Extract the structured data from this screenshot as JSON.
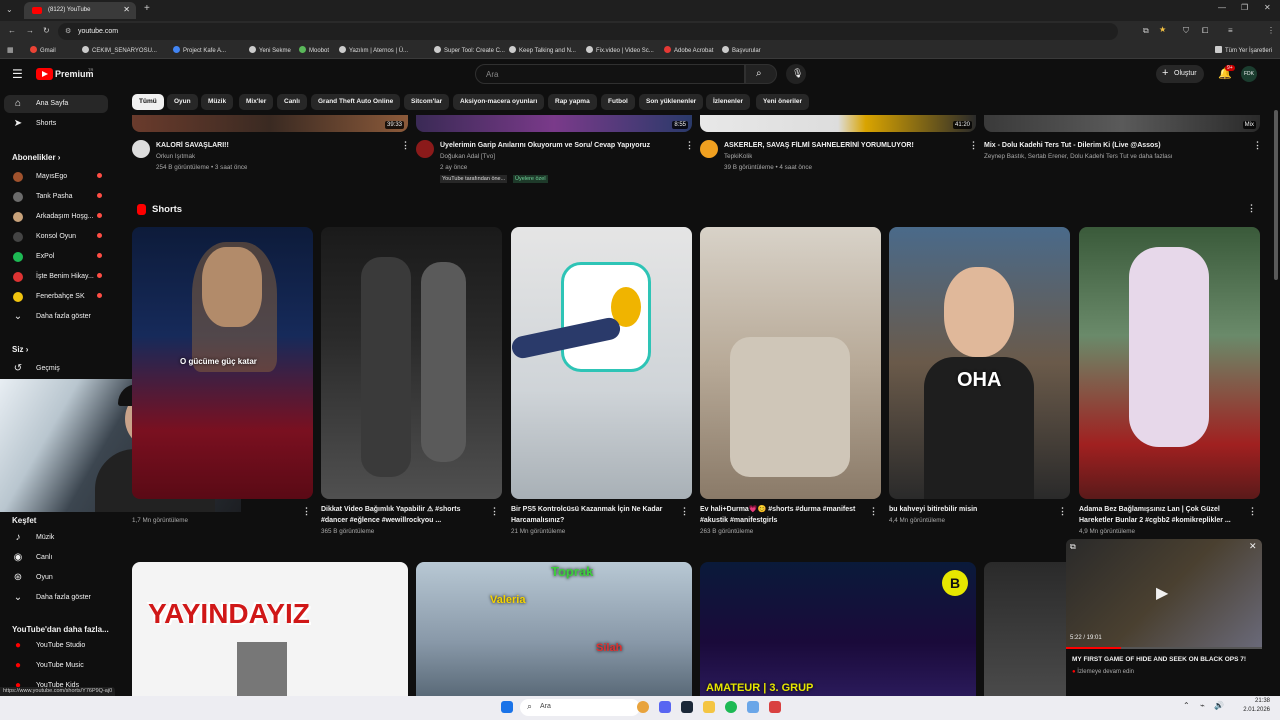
{
  "browser": {
    "tab_title": "(8122) YouTube",
    "url": "youtube.com",
    "bookmarks": [
      "Gmail",
      "CEKIM_SENARYOSU...",
      "Project Kafe A...",
      "Yeni Sekme",
      "Moobot",
      "Yazılım | Aternos | Ü...",
      "Super Tool: Create C...",
      "Keep Talking and N...",
      "Fix.video | Video Sc...",
      "Adobe Acrobat",
      "Başvurular"
    ],
    "all_bookmarks": "Tüm Yer İşaretleri"
  },
  "header": {
    "logo_text": "Premium",
    "logo_sup": "TR",
    "search_placeholder": "Ara",
    "create_label": "Oluştur",
    "notif_count": "9+",
    "avatar_text": "FDK"
  },
  "sidebar": {
    "home": "Ana Sayfa",
    "shorts": "Shorts",
    "subscriptions_title": "Abonelikler",
    "subs": [
      "MayısEgo",
      "Tank Pasha",
      "Arkadaşım Hoşg...",
      "Konsol Oyun",
      "ExPol",
      "İşte Benim Hikay...",
      "Fenerbahçe SK"
    ],
    "show_more": "Daha fazla göster",
    "you_title": "Siz",
    "history": "Geçmiş",
    "explore_title": "Keşfet",
    "explore": [
      "Müzik",
      "Canlı",
      "Oyun"
    ],
    "show_more2": "Daha fazla göster",
    "more_title": "YouTube'dan daha fazla...",
    "more_items": [
      "YouTube Studio",
      "YouTube Music",
      "YouTube Kids"
    ]
  },
  "chips": [
    "Tümü",
    "Oyun",
    "Müzik",
    "Mix'ler",
    "Canlı",
    "Grand Theft Auto Online",
    "Sitcom'lar",
    "Aksiyon-macera oyunları",
    "Rap yapma",
    "Futbol",
    "Son yüklenenler",
    "İzlenenler",
    "Yeni öneriler"
  ],
  "top_videos": [
    {
      "title": "KALORİ SAVAŞLARI!!",
      "channel": "Orkun Işıtmak",
      "meta": "254 B görüntüleme • 3 saat önce",
      "duration": "39:33"
    },
    {
      "title": "Üyelerimin Garip Anılarını Okuyorum ve Soru/ Cevap Yapıyoruz",
      "channel": "Doğukan Adal [Tvo]",
      "meta": "2 ay önce",
      "extra1": "YouTube tarafından öne...",
      "extra2": "Üyelere özel",
      "duration": "8:55"
    },
    {
      "title": "ASKERLER, SAVAŞ FİLMİ SAHNELERİNİ YORUMLUYOR!",
      "channel": "TepkiKolik",
      "meta": "39 B görüntüleme • 4 saat önce",
      "duration": "41:20"
    },
    {
      "title": "Mix - Dolu Kadehi Ters Tut - Dilerim Ki (Live @Assos)",
      "channel": "Zeynep Bastık, Sertab Erener, Dolu Kadehi Ters Tut ve daha fazlası",
      "meta": "",
      "duration": "Mix"
    }
  ],
  "shorts_title": "Shorts",
  "shorts": [
    {
      "title": "",
      "views": "1,7 Mn görüntüleme",
      "overlay": "O gücüme güç katar"
    },
    {
      "title": "Dikkat Video Bağımlık Yapabilir ⚠ #shorts #dancer #eğlence #wewillrockyou ...",
      "views": "365 B görüntüleme",
      "overlay": ""
    },
    {
      "title": "Bir PS5 Kontrolcüsü Kazanmak İçin Ne Kadar Harcamalısınız?",
      "views": "21 Mn görüntüleme",
      "overlay": ""
    },
    {
      "title": "Ev hali+Durma💗😊 #shorts #durma #manifest #akustik #manifestgirls",
      "views": "263 B görüntüleme",
      "overlay": ""
    },
    {
      "title": "bu kahveyi bitirebilir misin",
      "views": "4,4 Mn görüntüleme",
      "overlay": "OHA"
    },
    {
      "title": "Adama Bez Bağlamışsınız Lan | Çok Güzel Hareketler Bunlar 2 #cgbb2 #komikreplikler ...",
      "views": "4,9 Mn görüntüleme",
      "overlay": ""
    }
  ],
  "bottom_overlays": [
    "YAYINDAYIZ",
    "Toprak",
    "Valeria",
    "Silah",
    "AMATEUR | 3. GRUP"
  ],
  "mini_player": {
    "time": "5:22 / 19:01",
    "title": "MY FIRST GAME OF HIDE AND SEEK ON BLACK OPS 7!",
    "subtitle": "İzlemeye devam edin"
  },
  "status_url": "https://www.youtube.com/shorts/Y76P9Q-aj0",
  "taskbar": {
    "search": "Ara",
    "time": "21:38",
    "date": "2.01.2026"
  },
  "colors": {
    "accent": "#ff0000",
    "bg": "#0f0f0f",
    "chip": "#272727"
  }
}
